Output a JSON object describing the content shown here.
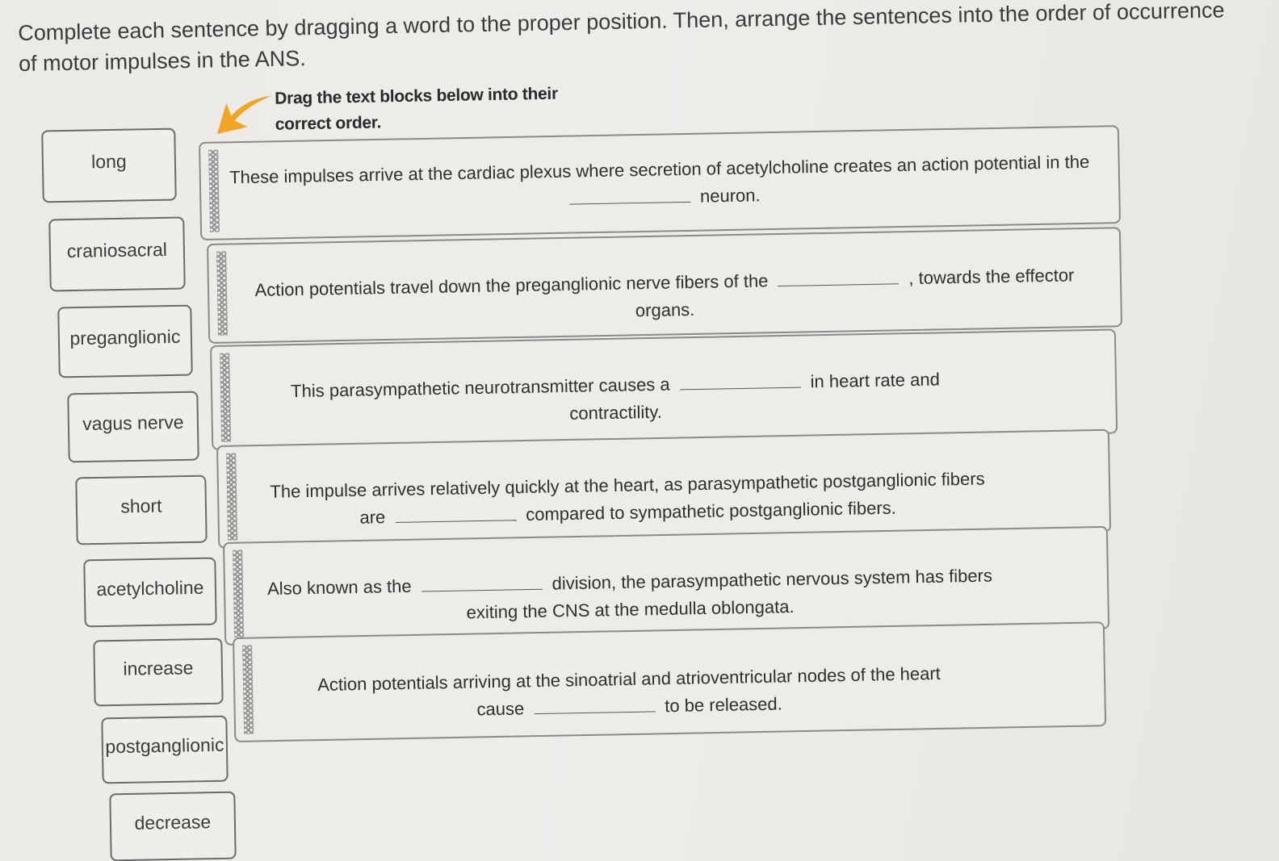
{
  "instructions": "Complete each sentence by dragging a word to the proper position. Then, arrange the sentences into the order of occurrence of motor impulses in the ANS.",
  "hint": {
    "icon": "arrow-pointer-icon",
    "text": "Drag the text blocks below into their correct order."
  },
  "accent_color": "#f0a623",
  "word_bank": [
    "long",
    "craniosacral",
    "preganglionic",
    "vagus nerve",
    "short",
    "acetylcholine",
    "increase",
    "postganglionic",
    "decrease"
  ],
  "sentences": [
    {
      "before": "These impulses arrive at the cardiac plexus where secretion of acetylcholine creates an action potential in the",
      "after": "neuron."
    },
    {
      "before": "Action potentials travel down the preganglionic nerve fibers of the",
      "after": ", towards the effector organs."
    },
    {
      "before": "This parasympathetic neurotransmitter causes a",
      "after": "in heart rate and contractility."
    },
    {
      "before": "The impulse arrives relatively quickly at the heart, as parasympathetic postganglionic fibers are",
      "after": "compared to sympathetic postganglionic fibers."
    },
    {
      "before": "Also known as the",
      "after": "division, the parasympathetic nervous system has fibers exiting the CNS at the medulla oblongata."
    },
    {
      "before": "Action potentials arriving at the sinoatrial and atrioventricular nodes of the heart cause",
      "after": "to be released."
    }
  ]
}
